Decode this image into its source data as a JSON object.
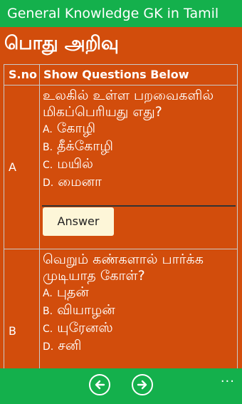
{
  "app": {
    "title": "General Knowledge GK in Tamil"
  },
  "page": {
    "heading": "பொது அறிவு"
  },
  "table": {
    "headers": [
      "S.no",
      "Show Questions Below"
    ],
    "rows": [
      {
        "sno": "A",
        "question": "உலகில் உள்ள பறவைகளில் மிகப்பெரியது எது?",
        "options": [
          {
            "key": "A.",
            "text": "கோழி"
          },
          {
            "key": "B.",
            "text": "தீக்கோழி"
          },
          {
            "key": "C.",
            "text": "மயில்"
          },
          {
            "key": "D.",
            "text": "மைனா"
          }
        ],
        "answer_label": "Answer"
      },
      {
        "sno": "B",
        "question": "வெறும் கண்களால் பார்க்க முடியாத கோள்?",
        "options": [
          {
            "key": "A.",
            "text": "புதன்"
          },
          {
            "key": "B.",
            "text": "வியாழன்"
          },
          {
            "key": "C.",
            "text": "யுரேனஸ்"
          },
          {
            "key": "D.",
            "text": "சனி"
          }
        ]
      }
    ]
  },
  "appbar": {
    "back_icon": "arrow-left-icon",
    "forward_icon": "arrow-right-icon",
    "more": "..."
  },
  "colors": {
    "background": "#d24d0c",
    "bar": "#14b04c",
    "answer_button": "#fdf6d8"
  }
}
